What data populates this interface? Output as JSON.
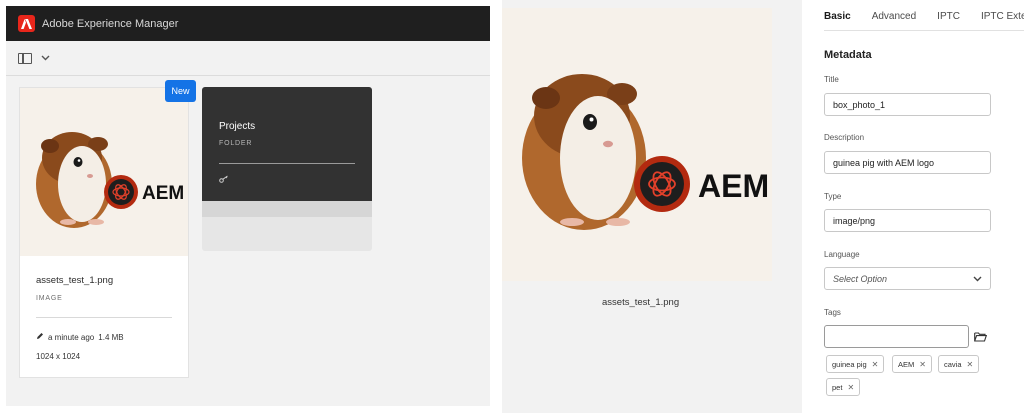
{
  "left": {
    "app_title": "Adobe Experience Manager",
    "asset_card": {
      "badge": "New",
      "name": "assets_test_1.png",
      "type": "IMAGE",
      "modified": "a minute ago",
      "size": "1.4 MB",
      "dimensions": "1024 x 1024",
      "logo_text": "AEM"
    },
    "folder_card": {
      "name": "Projects",
      "type": "FOLDER"
    }
  },
  "right": {
    "preview": {
      "filename": "assets_test_1.png",
      "logo_text": "AEM"
    },
    "tabs": [
      "Basic",
      "Advanced",
      "IPTC",
      "IPTC Extension"
    ],
    "section_title": "Metadata",
    "fields": {
      "title_label": "Title",
      "title_value": "box_photo_1",
      "description_label": "Description",
      "description_value": "guinea pig with AEM logo",
      "type_label": "Type",
      "type_value": "image/png",
      "language_label": "Language",
      "language_placeholder": "Select Option",
      "tags_label": "Tags"
    },
    "tags": [
      "guinea pig",
      "AEM",
      "cavia",
      "pet"
    ]
  },
  "colors": {
    "accent": "#1473e6",
    "brand_red": "#e8261b",
    "topbar": "#1f1f1f",
    "folder_dark": "#323232",
    "aem_logo_red": "#c42a0c"
  },
  "icons": [
    "adobe-logo",
    "rail-toggle-icon",
    "chevron-down-icon",
    "pencil-icon",
    "key-icon",
    "folder-browse-icon",
    "close-icon"
  ]
}
